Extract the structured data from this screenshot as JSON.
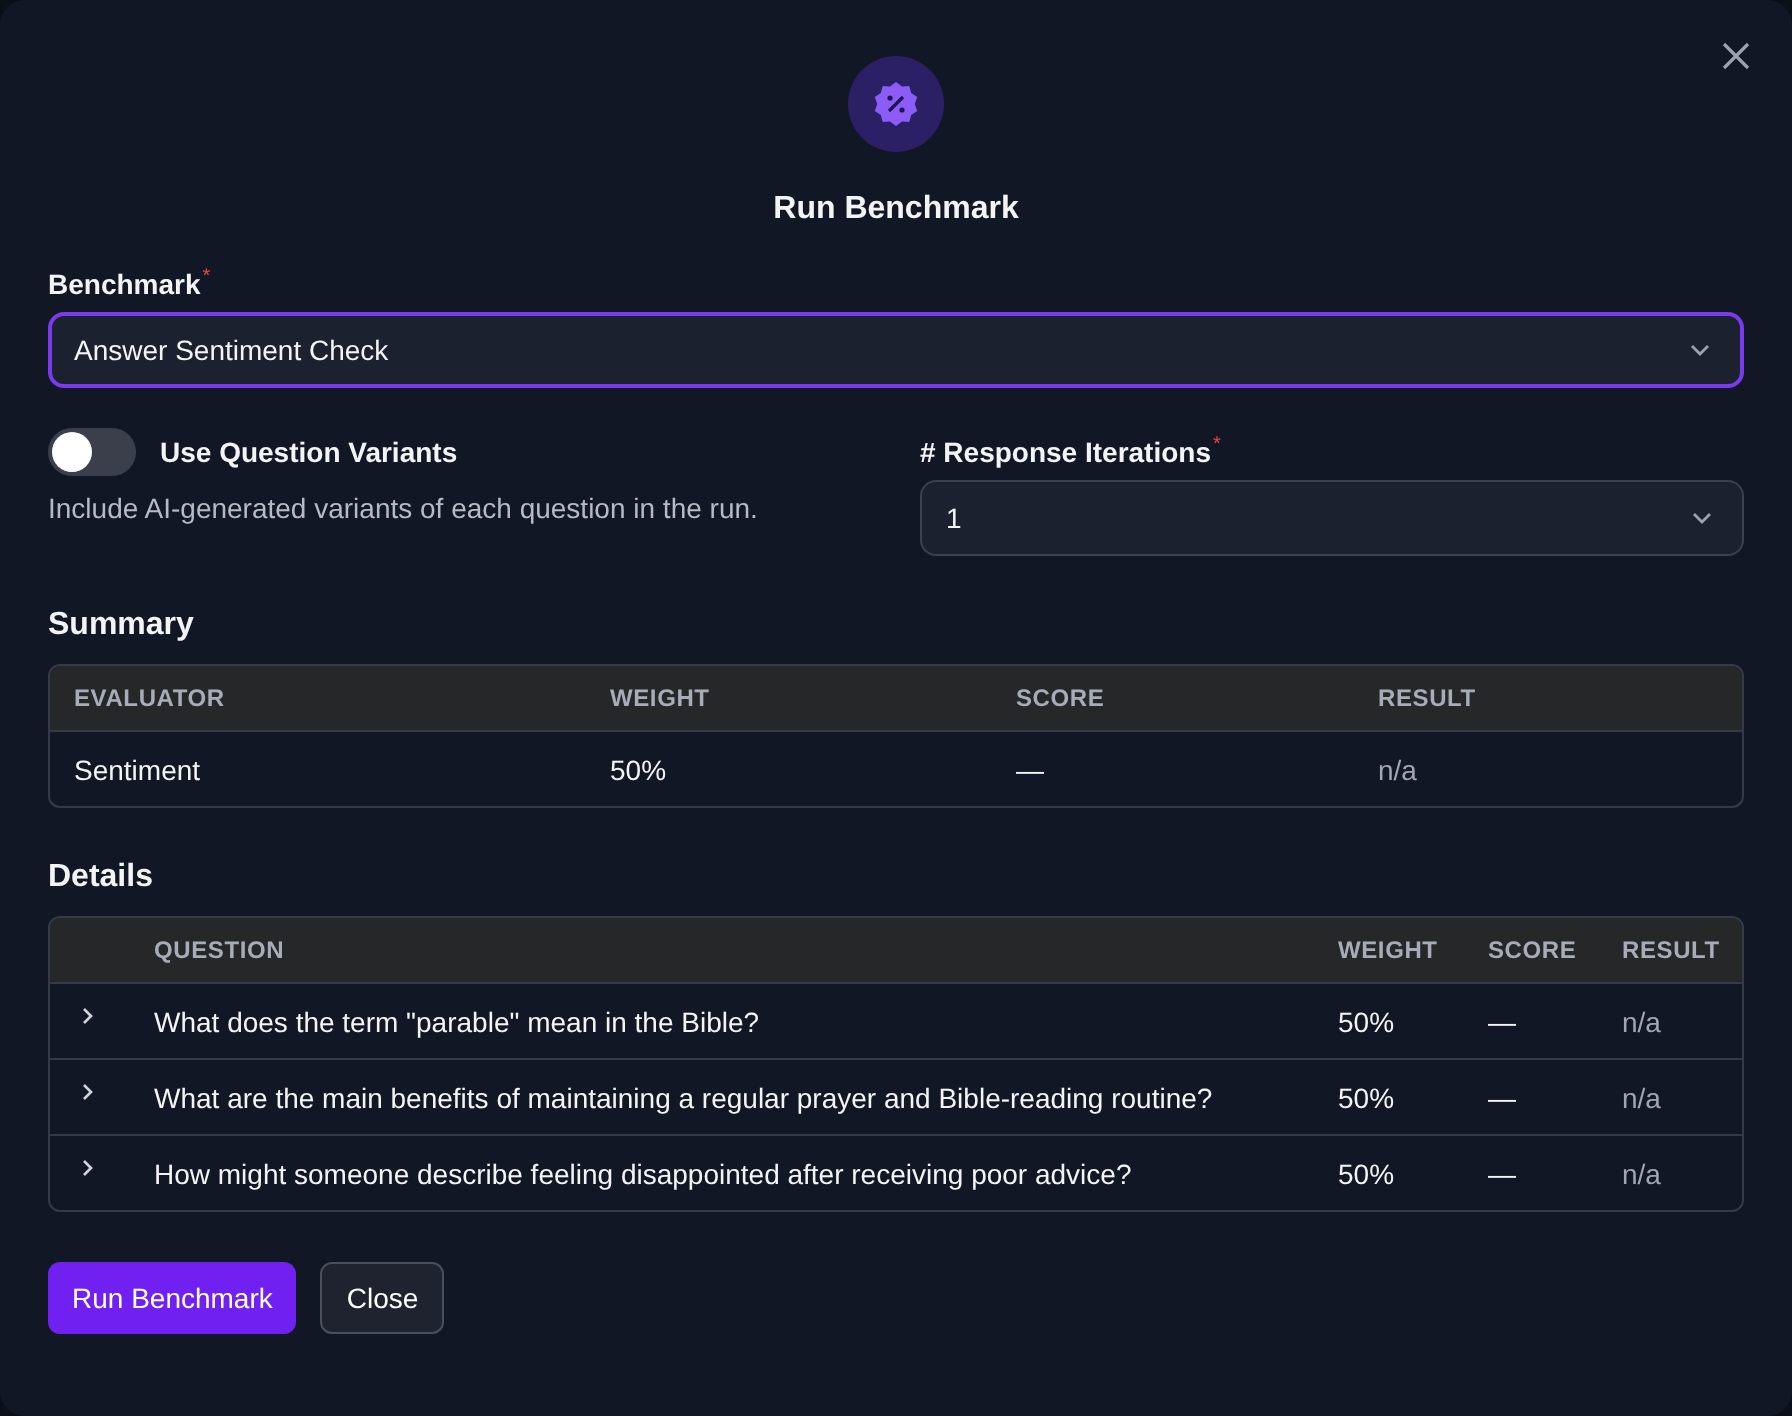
{
  "dialog": {
    "title": "Run Benchmark"
  },
  "benchmark": {
    "label": "Benchmark",
    "required_mark": "*",
    "value": "Answer Sentiment Check"
  },
  "variants": {
    "label": "Use Question Variants",
    "on": false,
    "description": "Include AI-generated variants of each question in the run."
  },
  "iterations": {
    "label": "# Response Iterations",
    "required_mark": "*",
    "value": "1"
  },
  "summary": {
    "title": "Summary",
    "columns": [
      "EVALUATOR",
      "WEIGHT",
      "SCORE",
      "RESULT"
    ],
    "rows": [
      [
        "Sentiment",
        "50%",
        "—",
        "n/a"
      ]
    ]
  },
  "details": {
    "title": "Details",
    "columns": [
      "QUESTION",
      "WEIGHT",
      "SCORE",
      "RESULT"
    ],
    "rows": [
      {
        "expanded": false,
        "cells": [
          "What does the term \"parable\" mean in the Bible?",
          "50%",
          "—",
          "n/a"
        ]
      },
      {
        "expanded": false,
        "cells": [
          "What are the main benefits of maintaining a regular prayer and Bible-reading routine?",
          "50%",
          "—",
          "n/a"
        ]
      },
      {
        "expanded": false,
        "cells": [
          "How might someone describe feeling disappointed after receiving poor advice?",
          "50%",
          "—",
          "n/a"
        ]
      }
    ]
  },
  "buttons": [
    {
      "label": "Run Benchmark",
      "kind": "primary"
    },
    {
      "label": "Close",
      "kind": "secondary"
    }
  ]
}
